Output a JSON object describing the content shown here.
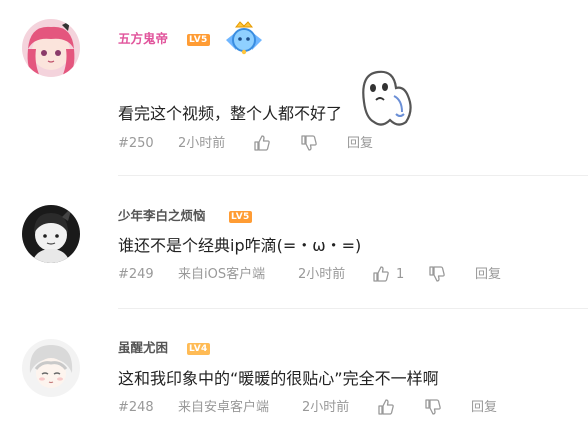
{
  "comments": [
    {
      "username": "五方鬼帝",
      "username_color": "#e1559c",
      "level": "LV5",
      "level_color": "#ff9c34",
      "text": "看完这个视频，整个人都不好了",
      "floor": "#250",
      "time": "2小时前",
      "reply": "回复",
      "has_medal": true,
      "has_sticker": true
    },
    {
      "username": "少年李白之烦恼",
      "username_color": "#555555",
      "level": "LV5",
      "level_color": "#ff9c34",
      "text": "谁还不是个经典ip咋滴(=・ω・=)",
      "floor": "#249",
      "source": "来自iOS客户端",
      "time": "2小时前",
      "likes": "1",
      "reply": "回复"
    },
    {
      "username": "虽醒尤困",
      "username_color": "#555555",
      "level": "LV4",
      "level_color": "#ffbb55",
      "text": "这和我印象中的“暖暖的很贴心”完全不一样啊",
      "floor": "#248",
      "source": "来自安卓客户端",
      "time": "2小时前",
      "reply": "回复"
    }
  ]
}
